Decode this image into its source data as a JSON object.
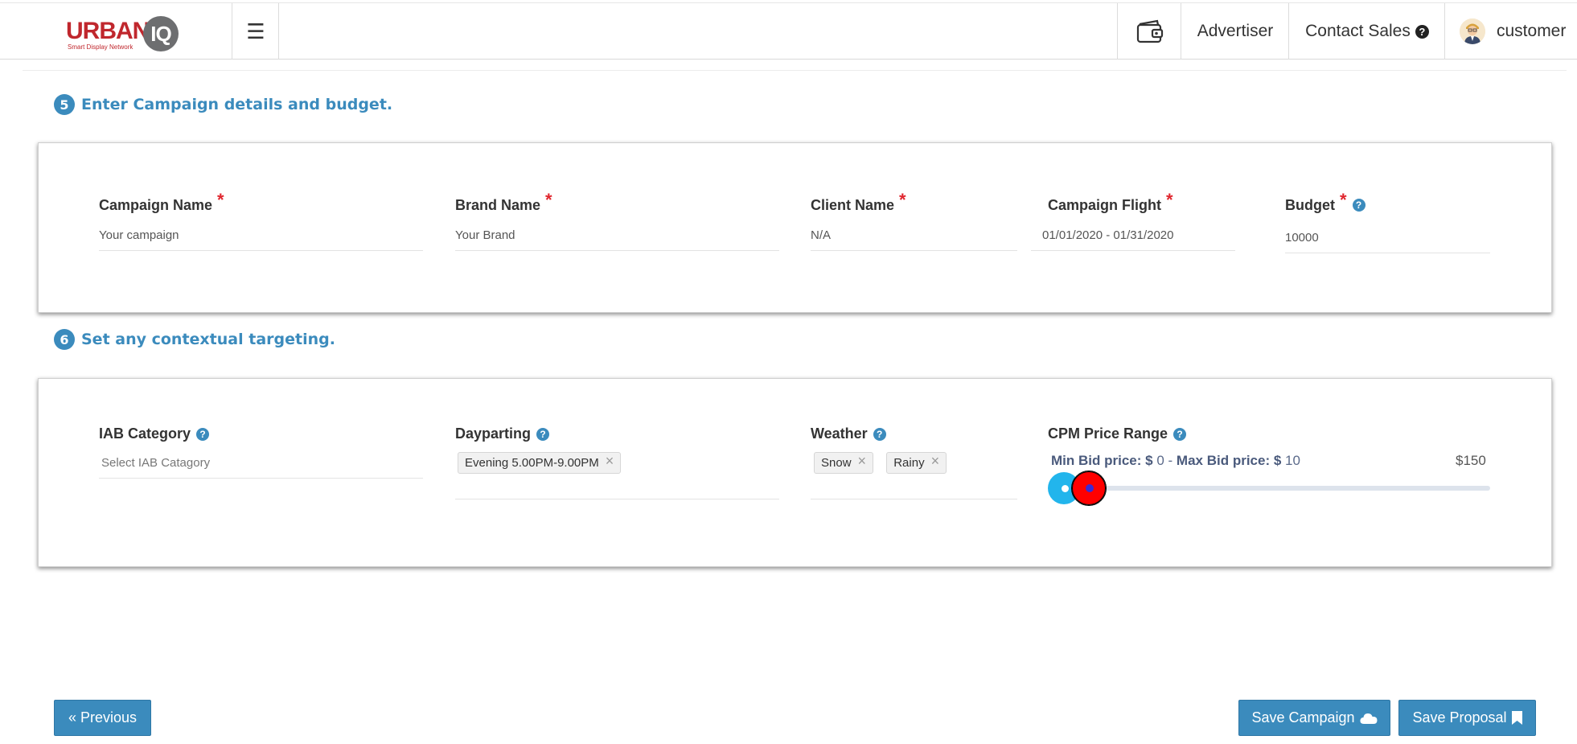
{
  "header": {
    "logo_main": "URBAN",
    "logo_badge": "IQ",
    "logo_tagline": "Smart Display Network",
    "wallet_icon": "wallet-icon",
    "advertiser_label": "Advertiser",
    "contact_label": "Contact Sales",
    "user_label": "customer"
  },
  "step5": {
    "number": "5",
    "title": "Enter Campaign details and budget.",
    "fields": {
      "campaign_name": {
        "label": "Campaign Name",
        "required": "*",
        "value": "Your campaign"
      },
      "brand_name": {
        "label": "Brand Name",
        "required": "*",
        "value": "Your Brand"
      },
      "client_name": {
        "label": "Client Name",
        "required": "*",
        "value": "N/A"
      },
      "campaign_flight": {
        "label": "Campaign Flight",
        "required": "*",
        "value": "01/01/2020 - 01/31/2020"
      },
      "budget": {
        "label": "Budget",
        "required": "*",
        "value": "10000"
      }
    }
  },
  "step6": {
    "number": "6",
    "title": "Set any contextual targeting.",
    "iab": {
      "label": "IAB Category",
      "placeholder": "Select  IAB Catagory"
    },
    "dayparting": {
      "label": "Dayparting",
      "tags": [
        "Evening 5.00PM-9.00PM"
      ]
    },
    "weather": {
      "label": "Weather",
      "tags": [
        "Snow",
        "Rainy"
      ]
    },
    "cpm": {
      "label": "CPM Price Range",
      "min_label": "Min Bid price: $",
      "min_value": "0",
      "separator": "-",
      "max_label": "Max Bid price: $",
      "max_value": "10",
      "range_max": "$150",
      "range_min_value": 0,
      "range_max_value": 150
    }
  },
  "footer": {
    "previous_label": "« Previous",
    "save_campaign_label": "Save Campaign",
    "save_proposal_label": "Save Proposal"
  },
  "colors": {
    "accent": "#3b8bbd",
    "required": "#e0262e",
    "slider_min_handle": "#22b5ec",
    "slider_max_handle": "#ff0000"
  }
}
